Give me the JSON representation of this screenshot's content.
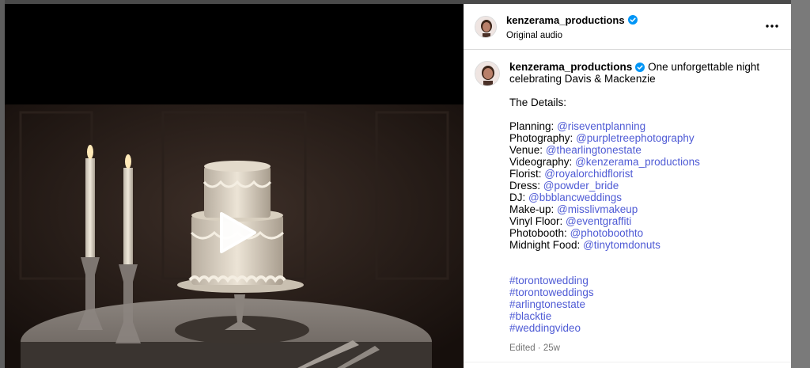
{
  "post": {
    "username": "kenzerama_productions",
    "audio": "Original audio",
    "caption_intro": "One unforgettable night celebrating Davis & Mackenzie",
    "caption_intro_line1": "One unforgettable night",
    "caption_intro_line2": "celebrating Davis & Mackenzie",
    "details_heading": "The Details:",
    "credits": [
      {
        "label": "Planning:",
        "handle": "@riseventplanning"
      },
      {
        "label": "Photography:",
        "handle": "@purpletreephotography"
      },
      {
        "label": "Venue:",
        "handle": "@thearlingtonestate"
      },
      {
        "label": "Videography:",
        "handle": "@kenzerama_productions"
      },
      {
        "label": "Florist:",
        "handle": "@royalorchidflorist"
      },
      {
        "label": "Dress:",
        "handle": "@powder_bride"
      },
      {
        "label": "DJ:",
        "handle": "@bbblancweddings"
      },
      {
        "label": "Make-up:",
        "handle": "@misslivmakeup"
      },
      {
        "label": "Vinyl Floor:",
        "handle": "@eventgraffiti"
      },
      {
        "label": "Photobooth:",
        "handle": "@photoboothto"
      },
      {
        "label": "Midnight Food:",
        "handle": "@tinytomdonuts"
      }
    ],
    "hashtags": [
      "#torontowedding",
      "#torontoweddings",
      "#arlingtonestate",
      "#blacktie",
      "#weddingvideo"
    ],
    "edited": "Edited · 25w"
  },
  "icons": {
    "verified": "verified-badge-icon",
    "more": "more-options-icon",
    "play": "play-icon"
  },
  "colors": {
    "link": "#4f5bd5",
    "verified": "#0095f6",
    "muted": "#737373"
  }
}
